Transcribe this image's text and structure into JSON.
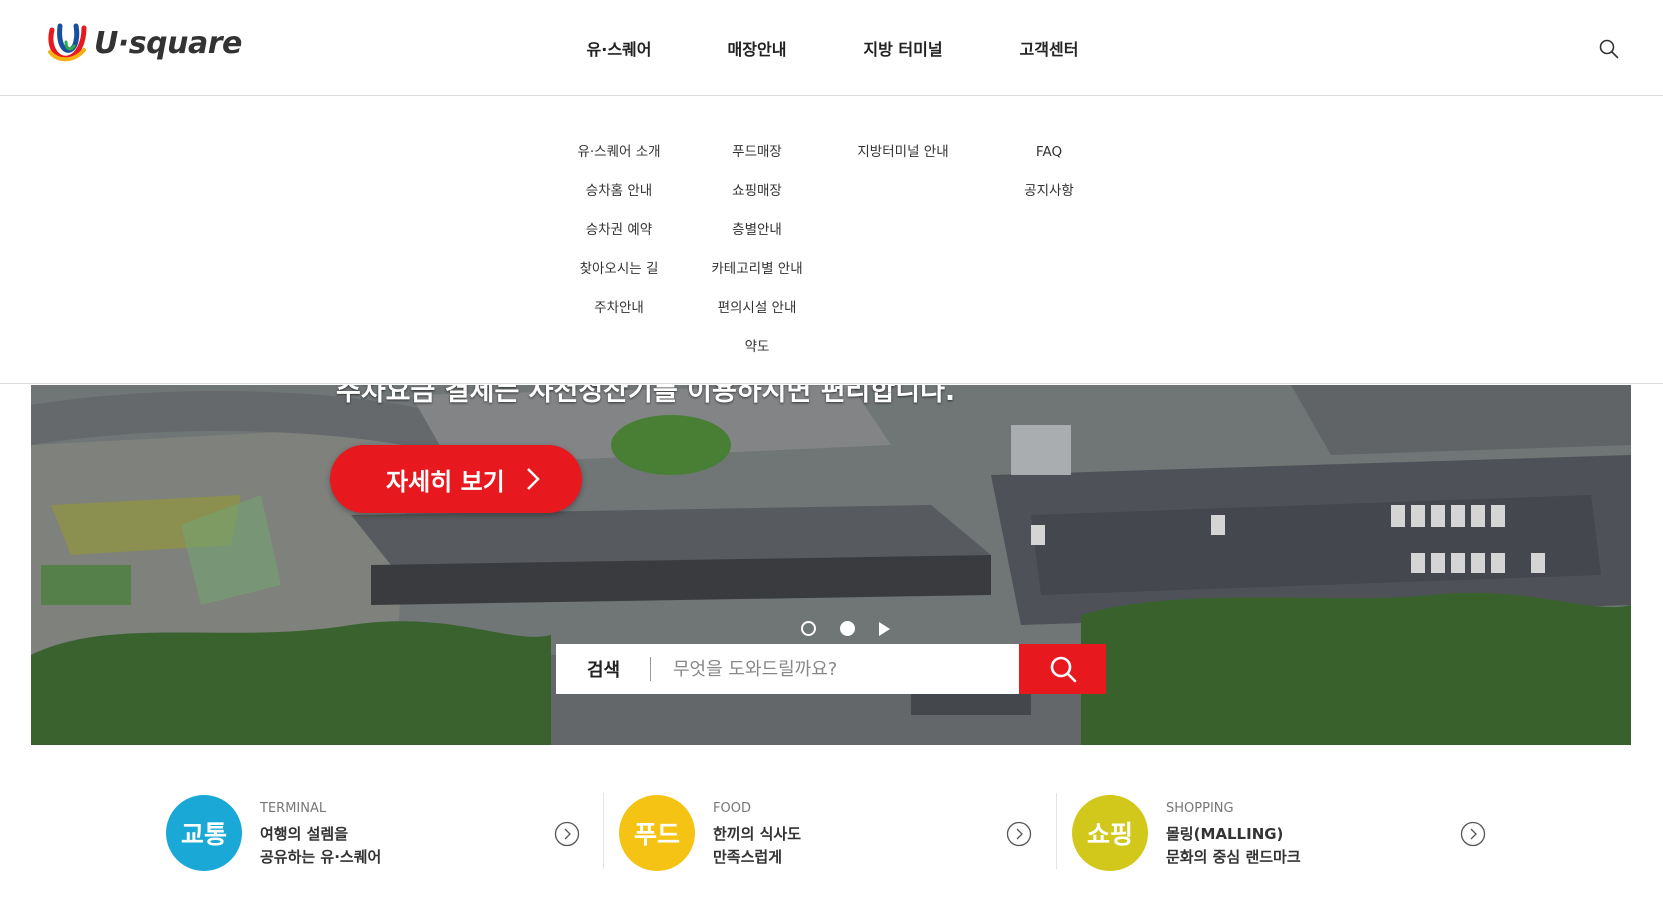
{
  "header": {
    "logo_text": "U·square",
    "nav": [
      "유·스퀘어",
      "매장안내",
      "지방 터미널",
      "고객센터"
    ]
  },
  "megamenu": {
    "columns": [
      [
        "유·스퀘어 소개",
        "승차홈 안내",
        "승차권 예약",
        "찾아오시는 길",
        "주차안내"
      ],
      [
        "푸드매장",
        "쇼핑매장",
        "층별안내",
        "카테고리별 안내",
        "편의시설 안내",
        "약도"
      ],
      [
        "지방터미널 안내"
      ],
      [
        "FAQ",
        "공지사항"
      ]
    ]
  },
  "hero": {
    "caption": "주차요금 결제는 사전정산기를 이용하시면 편리합니다.",
    "more_label": "자세히 보기",
    "search_label": "검색",
    "search_placeholder": "무엇을 도와드릴까요?"
  },
  "quick": [
    {
      "badge": "교통",
      "en": "TERMINAL",
      "line1": "여행의 설렘을",
      "line2": "공유하는 유·스퀘어",
      "color": "#1aa9d6"
    },
    {
      "badge": "푸드",
      "en": "FOOD",
      "line1": "한끼의 식사도",
      "line2": "만족스럽게",
      "color": "#f5c313"
    },
    {
      "badge": "쇼핑",
      "en": "SHOPPING",
      "line1": "몰링(MALLING)",
      "line2": "문화의 중심 랜드마크",
      "color": "#d2c81c"
    }
  ],
  "colors": {
    "accent": "#e8181f",
    "divider": "#dcdcdc"
  }
}
